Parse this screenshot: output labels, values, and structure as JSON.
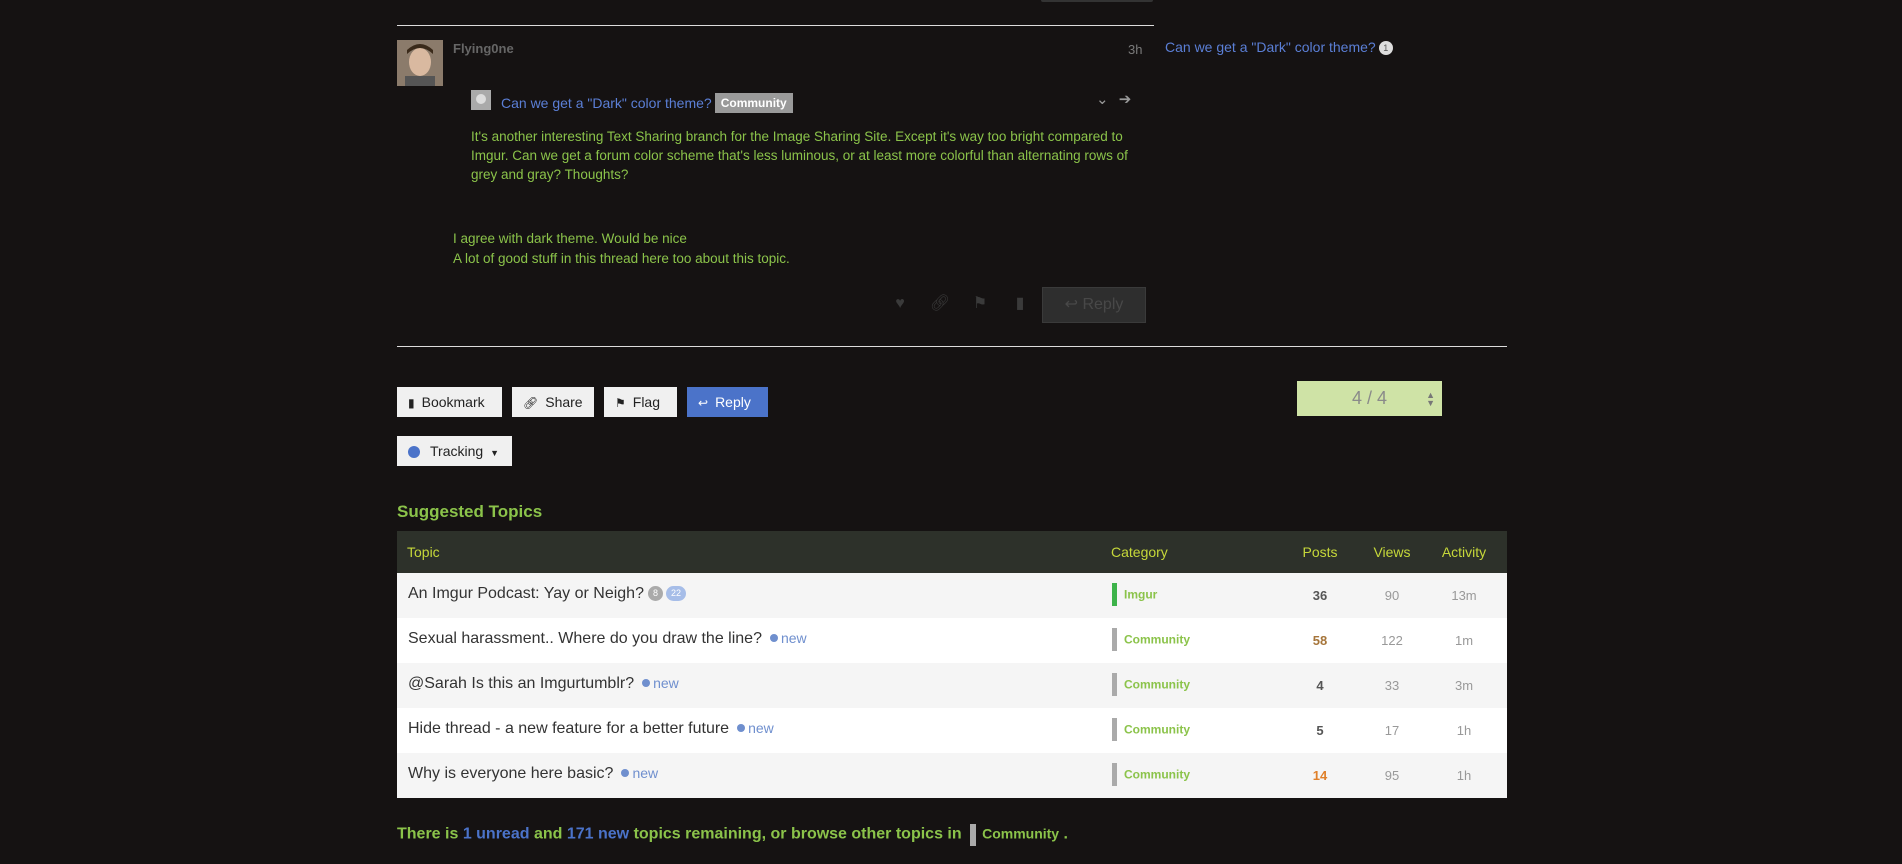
{
  "post": {
    "username": "Flying0ne",
    "time": "3h",
    "side_link": "Can we get a \"Dark\" color theme?",
    "side_link_count": "1",
    "quote": {
      "title": "Can we get a \"Dark\" color theme?",
      "category": "Community",
      "body": "It's another interesting Text Sharing branch for the Image Sharing Site. Except it's way too bright compared to Imgur. Can we get a forum color scheme that's less luminous, or at least more colorful than alternating rows of grey and gray? Thoughts?"
    },
    "body_lines": [
      "I agree with dark theme. Would be nice",
      "A lot of good stuff in this thread here too about this topic."
    ],
    "reply_label": "Reply"
  },
  "controls": {
    "bookmark": "Bookmark",
    "share": "Share",
    "flag": "Flag",
    "reply": "Reply",
    "progress": "4 / 4",
    "tracking": "Tracking"
  },
  "suggested": {
    "title": "Suggested Topics",
    "headers": {
      "topic": "Topic",
      "category": "Category",
      "posts": "Posts",
      "views": "Views",
      "activity": "Activity"
    },
    "rows": [
      {
        "title": "An Imgur Podcast: Yay or Neigh?",
        "badge1": "8",
        "badge2": "22",
        "new": "",
        "category": "Imgur",
        "cat_color": "#3db34a",
        "posts": "36",
        "posts_color": "#555555",
        "views": "90",
        "activity": "13m"
      },
      {
        "title": "Sexual harassment.. Where do you draw the line?",
        "badge1": "",
        "badge2": "",
        "new": "new",
        "category": "Community",
        "cat_color": "#aaaaaa",
        "posts": "58",
        "posts_color": "#a6753a",
        "views": "122",
        "activity": "1m"
      },
      {
        "title": "@Sarah Is this an Imgurtumblr?",
        "badge1": "",
        "badge2": "",
        "new": "new",
        "category": "Community",
        "cat_color": "#aaaaaa",
        "posts": "4",
        "posts_color": "#555555",
        "views": "33",
        "activity": "3m"
      },
      {
        "title": "Hide thread - a new feature for a better future",
        "badge1": "",
        "badge2": "",
        "new": "new",
        "category": "Community",
        "cat_color": "#aaaaaa",
        "posts": "5",
        "posts_color": "#555555",
        "views": "17",
        "activity": "1h"
      },
      {
        "title": "Why is everyone here basic?",
        "badge1": "",
        "badge2": "",
        "new": "new",
        "category": "Community",
        "cat_color": "#aaaaaa",
        "posts": "14",
        "posts_color": "#e0802a",
        "views": "95",
        "activity": "1h"
      }
    ]
  },
  "footer": {
    "prefix": "There is",
    "unread": "1 unread",
    "and": "and",
    "new": "171 new",
    "suffix": "topics remaining, or browse other topics in",
    "category": "Community",
    "end": "."
  }
}
